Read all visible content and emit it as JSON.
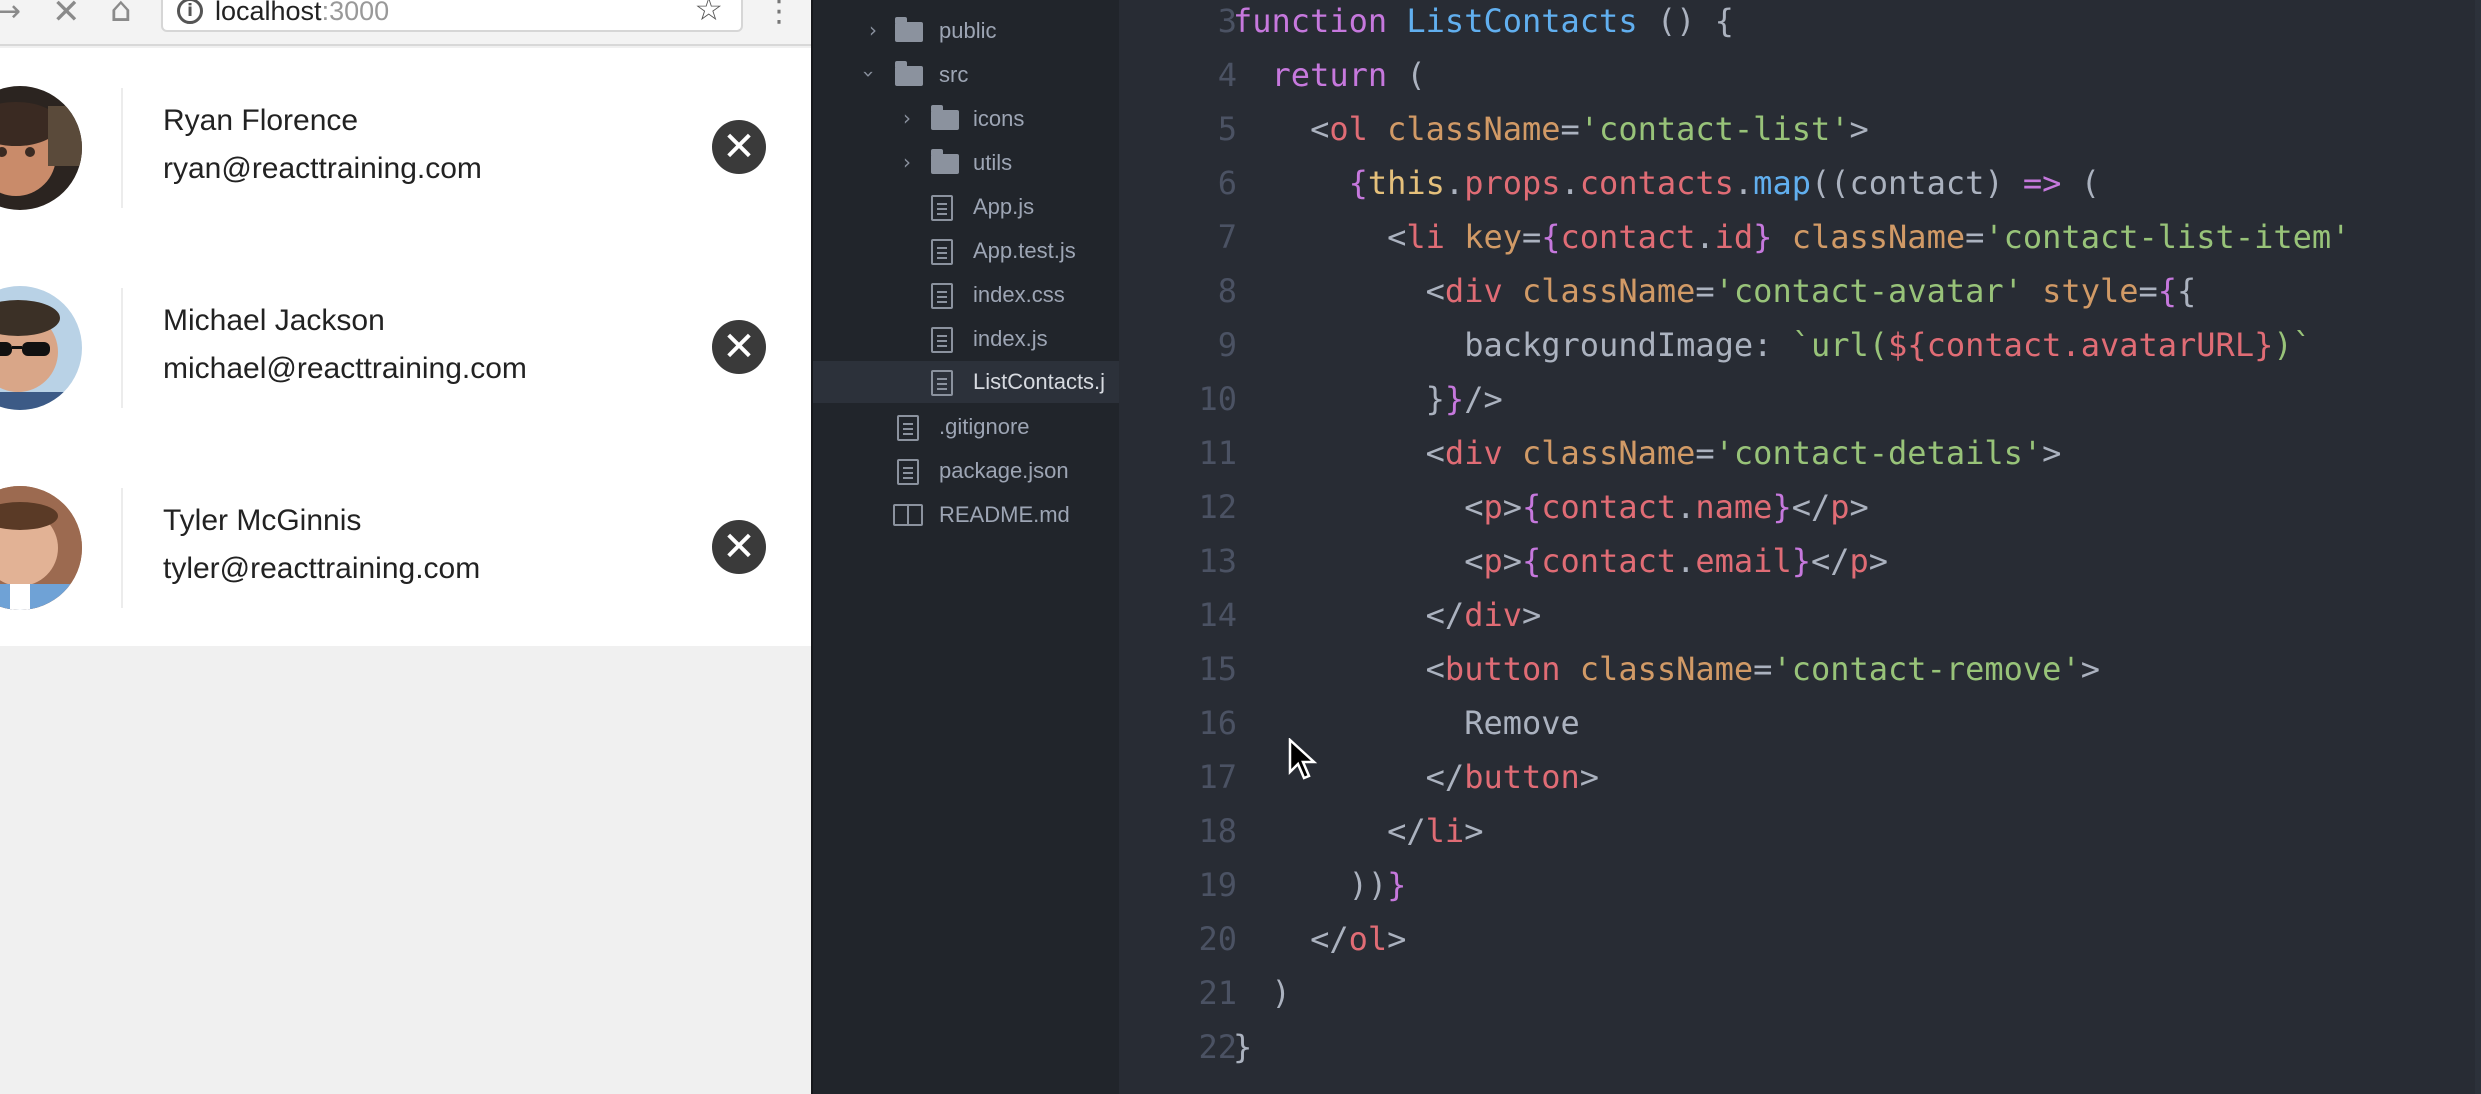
{
  "browser": {
    "url_host": "localhost",
    "url_port": ":3000",
    "icons": [
      "forward-icon",
      "stop-icon",
      "home-icon",
      "info-icon",
      "star-icon",
      "menu-icon"
    ]
  },
  "contacts": [
    {
      "name": "Ryan Florence",
      "email": "ryan@reacttraining.com"
    },
    {
      "name": "Michael Jackson",
      "email": "michael@reacttraining.com"
    },
    {
      "name": "Tyler McGinnis",
      "email": "tyler@reacttraining.com"
    }
  ],
  "tree": {
    "items": [
      {
        "label": "public",
        "type": "folder",
        "expanded": false
      },
      {
        "label": "src",
        "type": "folder",
        "expanded": true
      },
      {
        "label": "icons",
        "type": "folder",
        "expanded": false
      },
      {
        "label": "utils",
        "type": "folder",
        "expanded": false
      },
      {
        "label": "App.js",
        "type": "file"
      },
      {
        "label": "App.test.js",
        "type": "file"
      },
      {
        "label": "index.css",
        "type": "file"
      },
      {
        "label": "index.js",
        "type": "file"
      },
      {
        "label": "ListContacts.j",
        "type": "file",
        "selected": true
      },
      {
        "label": ".gitignore",
        "type": "file"
      },
      {
        "label": "package.json",
        "type": "file"
      },
      {
        "label": "README.md",
        "type": "book"
      }
    ]
  },
  "editor": {
    "line_numbers": [
      "3",
      "4",
      "5",
      "6",
      "7",
      "8",
      "9",
      "10",
      "11",
      "12",
      "13",
      "14",
      "15",
      "16",
      "17",
      "18",
      "19",
      "20",
      "21",
      "22"
    ],
    "lines": [
      [
        [
          "kw",
          "function "
        ],
        [
          "fn",
          "ListContacts "
        ],
        [
          "txt",
          "() {"
        ]
      ],
      [
        [
          "txt",
          "  "
        ],
        [
          "kw",
          "return "
        ],
        [
          "txt",
          "("
        ]
      ],
      [
        [
          "txt",
          "    <"
        ],
        [
          "tag",
          "ol "
        ],
        [
          "attr",
          "className"
        ],
        [
          "txt",
          "="
        ],
        [
          "str",
          "'contact-list'"
        ],
        [
          "txt",
          ">"
        ]
      ],
      [
        [
          "txt",
          "      "
        ],
        [
          "kw",
          "{"
        ],
        [
          "obj",
          "this"
        ],
        [
          "txt",
          "."
        ],
        [
          "tag",
          "props"
        ],
        [
          "txt",
          "."
        ],
        [
          "tag",
          "contacts"
        ],
        [
          "txt",
          "."
        ],
        [
          "fn",
          "map"
        ],
        [
          "txt",
          "((contact) "
        ],
        [
          "kw",
          "=> "
        ],
        [
          "txt",
          "("
        ]
      ],
      [
        [
          "txt",
          "        <"
        ],
        [
          "tag",
          "li "
        ],
        [
          "attr",
          "key"
        ],
        [
          "txt",
          "="
        ],
        [
          "kw",
          "{"
        ],
        [
          "tag",
          "contact"
        ],
        [
          "txt",
          "."
        ],
        [
          "tag",
          "id"
        ],
        [
          "kw",
          "} "
        ],
        [
          "attr",
          "className"
        ],
        [
          "txt",
          "="
        ],
        [
          "str",
          "'contact-list-item'"
        ]
      ],
      [
        [
          "txt",
          "          <"
        ],
        [
          "tag",
          "div "
        ],
        [
          "attr",
          "className"
        ],
        [
          "txt",
          "="
        ],
        [
          "str",
          "'contact-avatar' "
        ],
        [
          "attr",
          "style"
        ],
        [
          "txt",
          "="
        ],
        [
          "kw",
          "{"
        ],
        [
          "txt",
          "{"
        ]
      ],
      [
        [
          "txt",
          "            backgroundImage: "
        ],
        [
          "str",
          "`url("
        ],
        [
          "tag",
          "${contact.avatarURL}"
        ],
        [
          "str",
          ")`"
        ]
      ],
      [
        [
          "txt",
          "          }"
        ],
        [
          "kw",
          "}"
        ],
        [
          "txt",
          "/>"
        ]
      ],
      [
        [
          "txt",
          "          <"
        ],
        [
          "tag",
          "div "
        ],
        [
          "attr",
          "className"
        ],
        [
          "txt",
          "="
        ],
        [
          "str",
          "'contact-details'"
        ],
        [
          "txt",
          ">"
        ]
      ],
      [
        [
          "txt",
          "            <"
        ],
        [
          "tag",
          "p"
        ],
        [
          "txt",
          ">"
        ],
        [
          "kw",
          "{"
        ],
        [
          "tag",
          "contact"
        ],
        [
          "txt",
          "."
        ],
        [
          "tag",
          "name"
        ],
        [
          "kw",
          "}"
        ],
        [
          "txt",
          "</"
        ],
        [
          "tag",
          "p"
        ],
        [
          "txt",
          ">"
        ]
      ],
      [
        [
          "txt",
          "            <"
        ],
        [
          "tag",
          "p"
        ],
        [
          "txt",
          ">"
        ],
        [
          "kw",
          "{"
        ],
        [
          "tag",
          "contact"
        ],
        [
          "txt",
          "."
        ],
        [
          "tag",
          "email"
        ],
        [
          "kw",
          "}"
        ],
        [
          "txt",
          "</"
        ],
        [
          "tag",
          "p"
        ],
        [
          "txt",
          ">"
        ]
      ],
      [
        [
          "txt",
          "          </"
        ],
        [
          "tag",
          "div"
        ],
        [
          "txt",
          ">"
        ]
      ],
      [
        [
          "txt",
          "          <"
        ],
        [
          "tag",
          "button "
        ],
        [
          "attr",
          "className"
        ],
        [
          "txt",
          "="
        ],
        [
          "str",
          "'contact-remove'"
        ],
        [
          "txt",
          ">"
        ]
      ],
      [
        [
          "txt",
          "            Remove"
        ]
      ],
      [
        [
          "txt",
          "          </"
        ],
        [
          "tag",
          "button"
        ],
        [
          "txt",
          ">"
        ]
      ],
      [
        [
          "txt",
          "        </"
        ],
        [
          "tag",
          "li"
        ],
        [
          "txt",
          ">"
        ]
      ],
      [
        [
          "txt",
          "      ))"
        ],
        [
          "kw",
          "}"
        ]
      ],
      [
        [
          "txt",
          "    </"
        ],
        [
          "tag",
          "ol"
        ],
        [
          "txt",
          ">"
        ]
      ],
      [
        [
          "txt",
          "  )"
        ]
      ],
      [
        [
          "txt",
          "}"
        ]
      ]
    ]
  }
}
